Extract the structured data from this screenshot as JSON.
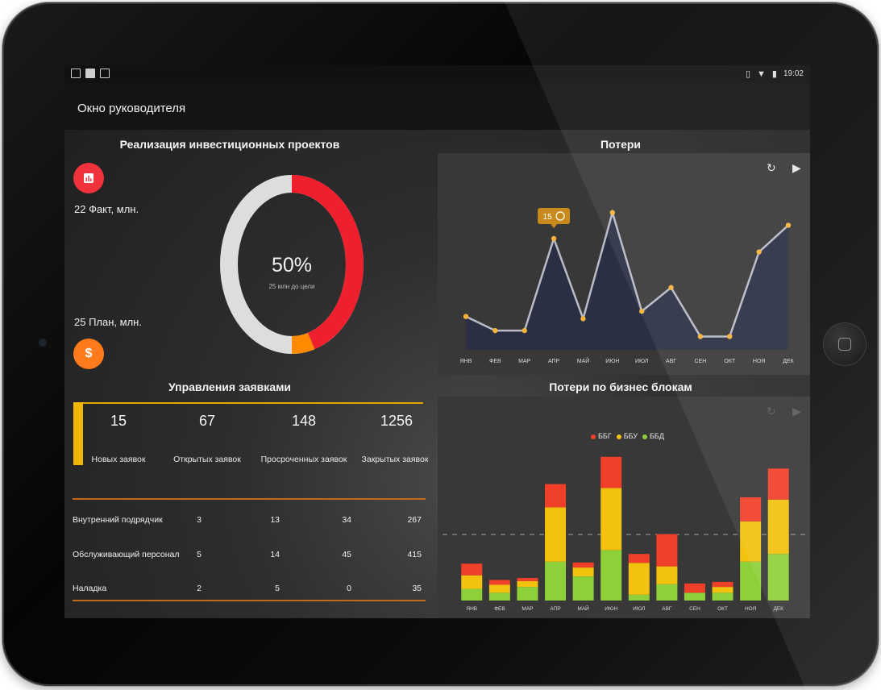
{
  "statusbar": {
    "time": "19:02",
    "left_icons": [
      "image-icon",
      "calendar-icon",
      "gmail-icon"
    ],
    "right_icons": [
      "vibrate-icon",
      "wifi-icon",
      "battery-icon"
    ]
  },
  "appbar": {
    "title": "Окно руководителя"
  },
  "investments": {
    "title": "Реализация инвестиционных проектов",
    "fact_label": "22 Факт, млн.",
    "plan_label": "25 План, млн.",
    "fact_icon": "bar-chart-icon",
    "plan_icon": "dollar-icon",
    "percent_text": "50%",
    "sub_text": "25 млн до цели",
    "ring": {
      "red_fraction": 0.45,
      "orange_fraction": 0.05,
      "gray_fraction": 0.5
    },
    "colors": {
      "red": "#f01f2e",
      "orange": "#ff8a00",
      "gray": "#dddddd"
    }
  },
  "losses": {
    "title": "Потери",
    "tooltip_value": "15",
    "refresh_icon": "refresh-icon",
    "play_icon": "play-icon"
  },
  "requests": {
    "title": "Управления заявками",
    "summary": [
      {
        "value": "15",
        "label": "Новых заявок"
      },
      {
        "value": "67",
        "label": "Открытых заявок"
      },
      {
        "value": "148",
        "label": "Просроченных заявок"
      },
      {
        "value": "1256",
        "label": "Закрытых заявок"
      }
    ],
    "rows": [
      {
        "name": "Внутренний подрядчик",
        "values": [
          "3",
          "13",
          "34",
          "267"
        ]
      },
      {
        "name": "Обслуживающий персонал",
        "values": [
          "5",
          "14",
          "45",
          "415"
        ]
      },
      {
        "name": "Наладка",
        "values": [
          "2",
          "5",
          "0",
          "35"
        ]
      }
    ]
  },
  "business": {
    "title": "Потери по бизнес блокам",
    "legend": [
      {
        "name": "ББГ",
        "color": "#f0402a"
      },
      {
        "name": "ББУ",
        "color": "#f2c20f"
      },
      {
        "name": "ББД",
        "color": "#8ed03a"
      }
    ]
  },
  "chart_data": [
    {
      "type": "area",
      "categories": [
        "ЯНВ",
        "ФЕВ",
        "МАР",
        "АПР",
        "МАЙ",
        "ИЮН",
        "ИЮЛ",
        "АВГ",
        "СЕН",
        "ОКТ",
        "НОЯ",
        "ДЕК"
      ],
      "values": [
        4.5,
        2.6,
        2.6,
        15,
        4.2,
        18.5,
        5.2,
        8.4,
        1.8,
        1.8,
        13.2,
        16.8
      ],
      "ylim": [
        0,
        20
      ],
      "highlight": {
        "index": 3,
        "label": "15"
      },
      "colors": {
        "line": "#b9bcc6",
        "fill": "#2a2f45",
        "point": "#f5b33a"
      },
      "grid": false
    },
    {
      "type": "bar",
      "stacked": true,
      "categories": [
        "ЯНВ",
        "ФЕВ",
        "МАР",
        "АПР",
        "МАЙ",
        "ИЮН",
        "ИЮЛ",
        "АВГ",
        "СЕН",
        "ОКТ",
        "НОЯ",
        "ДЕК"
      ],
      "series": [
        {
          "name": "ББД",
          "values": [
            3,
            2,
            3.5,
            10,
            6.2,
            13,
            1.5,
            4.2,
            2,
            2,
            10,
            12
          ]
        },
        {
          "name": "ББУ",
          "values": [
            3.5,
            2.1,
            1.5,
            14,
            2.3,
            16,
            8.2,
            4.6,
            0,
            1.5,
            10.4,
            14
          ]
        },
        {
          "name": "ББГ",
          "values": [
            3,
            1.2,
            0.8,
            6,
            1.3,
            8,
            2.3,
            8.3,
            2.4,
            1.3,
            6.2,
            8
          ]
        }
      ],
      "ylim": [
        0,
        38
      ],
      "reference_line": 17,
      "grid": false
    }
  ]
}
